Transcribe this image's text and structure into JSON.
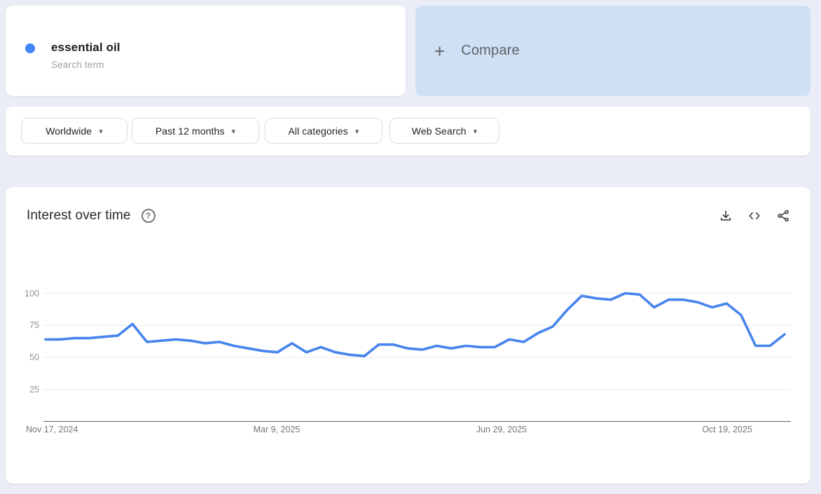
{
  "search_card": {
    "term": "essential oil",
    "subtitle": "Search term"
  },
  "compare_card": {
    "plus": "+",
    "label": "Compare"
  },
  "filters": {
    "region": "Worldwide",
    "time": "Past 12 months",
    "category": "All categories",
    "search_type": "Web Search",
    "dropdown_glyph": "▾"
  },
  "chart_section": {
    "title": "Interest over time",
    "help_glyph": "?"
  },
  "chart_data": {
    "type": "line",
    "title": "Interest over time",
    "x_unit": "week",
    "x": [
      "Nov 17, 2024",
      "Nov 24, 2024",
      "Dec 1, 2024",
      "Dec 8, 2024",
      "Dec 15, 2024",
      "Dec 22, 2024",
      "Dec 29, 2024",
      "Jan 5, 2025",
      "Jan 12, 2025",
      "Jan 19, 2025",
      "Jan 26, 2025",
      "Feb 2, 2025",
      "Feb 9, 2025",
      "Feb 16, 2025",
      "Feb 23, 2025",
      "Mar 2, 2025",
      "Mar 9, 2025",
      "Mar 16, 2025",
      "Mar 23, 2025",
      "Mar 30, 2025",
      "Apr 6, 2025",
      "Apr 13, 2025",
      "Apr 20, 2025",
      "Apr 27, 2025",
      "May 4, 2025",
      "May 11, 2025",
      "May 18, 2025",
      "May 25, 2025",
      "Jun 1, 2025",
      "Jun 8, 2025",
      "Jun 15, 2025",
      "Jun 22, 2025",
      "Jun 29, 2025",
      "Jul 6, 2025",
      "Jul 13, 2025",
      "Jul 20, 2025",
      "Jul 27, 2025",
      "Aug 3, 2025",
      "Aug 10, 2025",
      "Aug 17, 2025",
      "Aug 24, 2025",
      "Aug 31, 2025",
      "Sep 7, 2025",
      "Sep 14, 2025",
      "Sep 21, 2025",
      "Sep 28, 2025",
      "Oct 5, 2025",
      "Oct 12, 2025",
      "Oct 19, 2025",
      "Oct 26, 2025",
      "Nov 2, 2025",
      "Nov 9, 2025"
    ],
    "series": [
      {
        "name": "essential oil",
        "color": "#4684ee",
        "values": [
          64,
          64,
          65,
          65,
          66,
          67,
          76,
          62,
          63,
          64,
          63,
          61,
          62,
          59,
          57,
          55,
          54,
          61,
          54,
          58,
          54,
          52,
          51,
          60,
          60,
          57,
          56,
          59,
          57,
          59,
          58,
          58,
          64,
          62,
          69,
          74,
          87,
          98,
          96,
          95,
          100,
          99,
          89,
          95,
          95,
          93,
          89,
          92,
          83,
          59,
          59,
          68
        ]
      }
    ],
    "ylim": [
      0,
      100
    ],
    "y_ticks": [
      25,
      50,
      75,
      100
    ],
    "y_tick_labels": [
      "100",
      "75",
      "50",
      "25"
    ],
    "x_tick_labels": [
      "Nov 17, 2024",
      "Mar 9, 2025",
      "Jun 29, 2025",
      "Oct 19, 2025"
    ],
    "x_tick_indices": [
      0,
      16,
      32,
      48
    ],
    "grid": true,
    "legend": "none"
  },
  "colors": {
    "accent_blue": "#4285f4",
    "line_blue": "#4684ee",
    "page_bg": "#eaedf6",
    "compare_bg": "#cfdff4",
    "card_bg": "#ffffff",
    "gridline": "#e7e7e7",
    "axis_line": "#75797e",
    "text_dark": "#202124",
    "text_gray": "#5f6368",
    "tick_gray": "#8f9399"
  }
}
